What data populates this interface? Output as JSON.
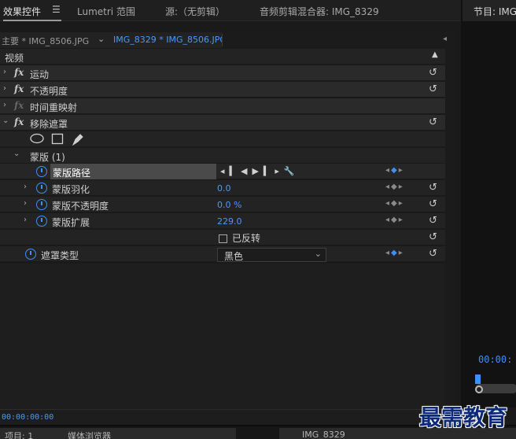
{
  "panel_tabs": {
    "effect_controls": "效果控件",
    "menu": "☰",
    "lumetri": "Lumetri 范围",
    "source": "源:（无剪辑）",
    "audio_mixer": "音频剪辑混合器: IMG_8329"
  },
  "program_monitor": {
    "title": "节目: IMG_",
    "timecode": "00:00:"
  },
  "clip_selector": {
    "master": "主要 * IMG_8506.JPG",
    "sequence": "IMG_8329 * IMG_8506.JPG"
  },
  "sections": {
    "video": "视频",
    "motion": "运动",
    "opacity": "不透明度",
    "time_remap": "时间重映射",
    "remove_matte": "移除遮罩"
  },
  "mask": {
    "header": "蒙版 (1)",
    "path": "蒙版路径",
    "feather": {
      "label": "蒙版羽化",
      "value": "0.0"
    },
    "opacity": {
      "label": "蒙版不透明度",
      "value": "0.0 %"
    },
    "expansion": {
      "label": "蒙版扩展",
      "value": "229.0"
    },
    "inverted": "已反转"
  },
  "matte_type": {
    "label": "遮罩类型",
    "selected": "黑色"
  },
  "timecode": "00:00:00:00",
  "bottom_tabs": {
    "project": "项目: 1",
    "media_browser": "媒体浏览器",
    "sequence": "IMG_8329"
  },
  "watermark": "最需教育",
  "colors": {
    "accent": "#3d8fff",
    "value_text": "#4a98ff"
  },
  "icons": {
    "fx": "fx",
    "reset": "↺",
    "expand": "›",
    "collapse": "⌄"
  }
}
